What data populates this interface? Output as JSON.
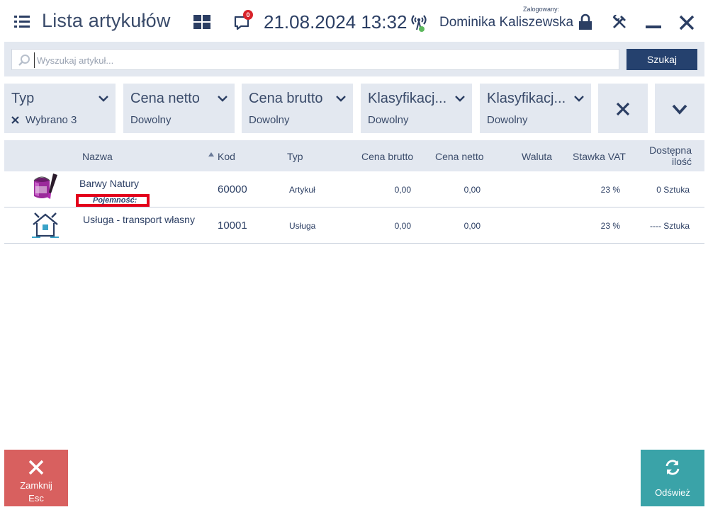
{
  "header": {
    "title": "Lista artykułów",
    "notifications_count": "0",
    "datetime": "21.08.2024 13:32",
    "logged_label": "Zalogowany:",
    "user_name": "Dominika Kaliszewska"
  },
  "search": {
    "placeholder": "Wyszukaj artykuł...",
    "value": "",
    "button_label": "Szukaj"
  },
  "filters": [
    {
      "label": "Typ",
      "value": "Wybrano 3",
      "clearable": true
    },
    {
      "label": "Cena netto",
      "value": "Dowolny"
    },
    {
      "label": "Cena brutto",
      "value": "Dowolny"
    },
    {
      "label": "Klasyfikacj...",
      "value": "Dowolny"
    },
    {
      "label": "Klasyfikacj...",
      "value": "Dowolny"
    }
  ],
  "table": {
    "columns": {
      "name": "Nazwa",
      "code": "Kod",
      "type": "Typ",
      "price_gross": "Cena brutto",
      "price_net": "Cena netto",
      "currency": "Waluta",
      "vat": "Stawka VAT",
      "available_line1": "Dostępna",
      "available_line2": "ilość"
    },
    "rows": [
      {
        "icon": "paint-bucket-icon",
        "name": "Barwy Natury",
        "attribute": "Pojemność:",
        "code": "60000",
        "type": "Artykuł",
        "price_gross": "0,00",
        "price_net": "0,00",
        "currency": "",
        "vat": "23 %",
        "available": "0 Sztuka"
      },
      {
        "icon": "house-tools-icon",
        "name": "Usługa - transport własny",
        "code": "10001",
        "type": "Usługa",
        "price_gross": "0,00",
        "price_net": "0,00",
        "currency": "",
        "vat": "23 %",
        "available": "---- Sztuka"
      }
    ]
  },
  "footer": {
    "close_label": "Zamknij",
    "close_shortcut": "Esc",
    "refresh_label": "Odśwież"
  },
  "colors": {
    "primary": "#25416e",
    "panel": "#e3e8f0",
    "close_button": "#d8605f",
    "refresh_button": "#3aa3a8",
    "badge": "#d8232a",
    "highlight_box": "#e3001b"
  }
}
